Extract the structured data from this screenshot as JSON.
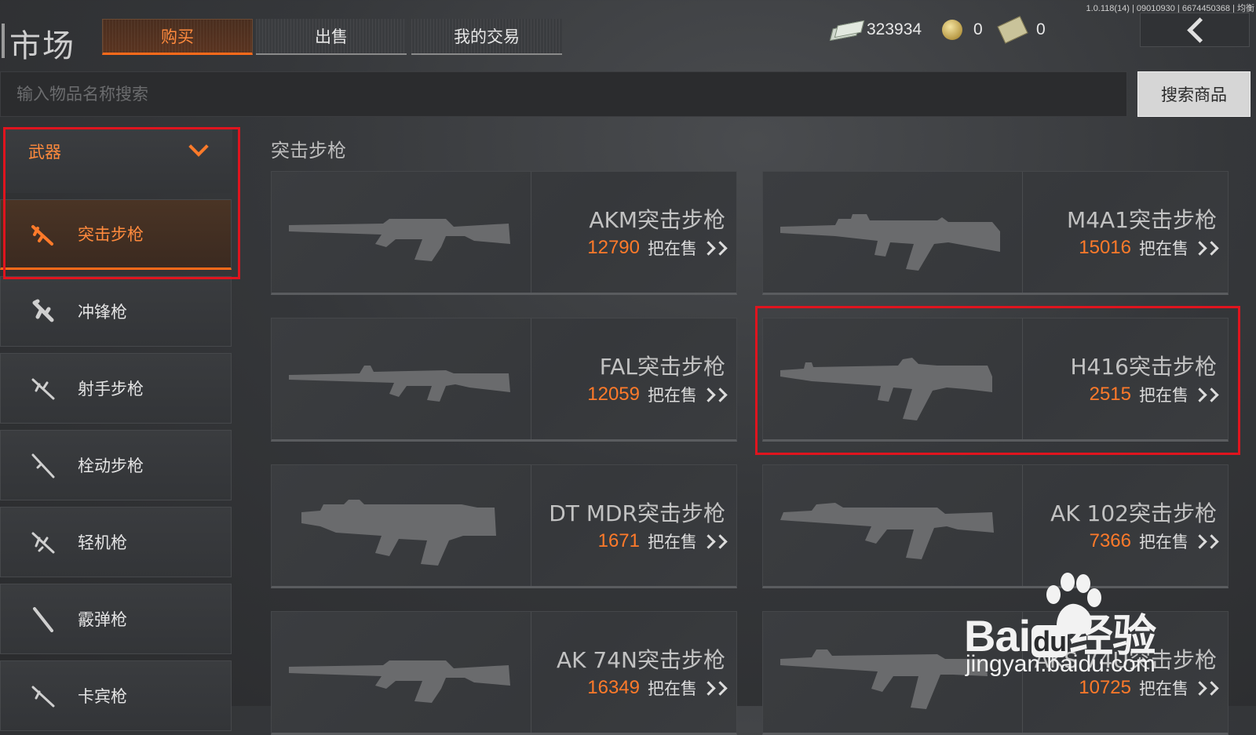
{
  "version": "1.0.118(14) | 09010930 | 6674450368 | 均衡",
  "header": {
    "title": "市场",
    "tabs": [
      {
        "label": "购买",
        "active": true
      },
      {
        "label": "出售",
        "active": false
      },
      {
        "label": "我的交易",
        "active": false
      }
    ],
    "currencies": [
      {
        "icon": "cash-icon",
        "value": "323934"
      },
      {
        "icon": "coin-icon",
        "value": "0"
      },
      {
        "icon": "ticket-icon",
        "value": "0"
      }
    ],
    "back_icon": "back-chevron-icon"
  },
  "search": {
    "placeholder": "输入物品名称搜索",
    "value": "",
    "button_label": "搜索商品"
  },
  "sidebar": {
    "category": {
      "label": "武器",
      "expanded": true
    },
    "items": [
      {
        "label": "突击步枪",
        "icon": "assault-rifle-icon",
        "active": true
      },
      {
        "label": "冲锋枪",
        "icon": "smg-icon",
        "active": false
      },
      {
        "label": "射手步枪",
        "icon": "marksman-rifle-icon",
        "active": false
      },
      {
        "label": "栓动步枪",
        "icon": "bolt-action-rifle-icon",
        "active": false
      },
      {
        "label": "轻机枪",
        "icon": "lmg-icon",
        "active": false
      },
      {
        "label": "霰弹枪",
        "icon": "shotgun-icon",
        "active": false
      },
      {
        "label": "卡宾枪",
        "icon": "carbine-icon",
        "active": false
      }
    ]
  },
  "main": {
    "section_title": "突击步枪",
    "sale_label": "把在售",
    "products": [
      {
        "name": "AKM突击步枪",
        "count": "12790"
      },
      {
        "name": "M4A1突击步枪",
        "count": "15016"
      },
      {
        "name": "FAL突击步枪",
        "count": "12059"
      },
      {
        "name": "H416突击步枪",
        "count": "2515",
        "highlighted": true
      },
      {
        "name": "DT MDR突击步枪",
        "count": "1671"
      },
      {
        "name": "AK 102突击步枪",
        "count": "7366"
      },
      {
        "name": "AK 74N突击步枪",
        "count": "16349"
      },
      {
        "name": "AKS 74U突击步枪",
        "count": "10725"
      }
    ]
  },
  "watermark": {
    "brand": "Bai",
    "brand_mid": "du",
    "brand_cn": "经验",
    "url": "jingyan.baidu.com"
  },
  "colors": {
    "accent": "#ff7a2a",
    "highlight_box": "#e0141e",
    "card_bg": "#3a3c3f"
  }
}
